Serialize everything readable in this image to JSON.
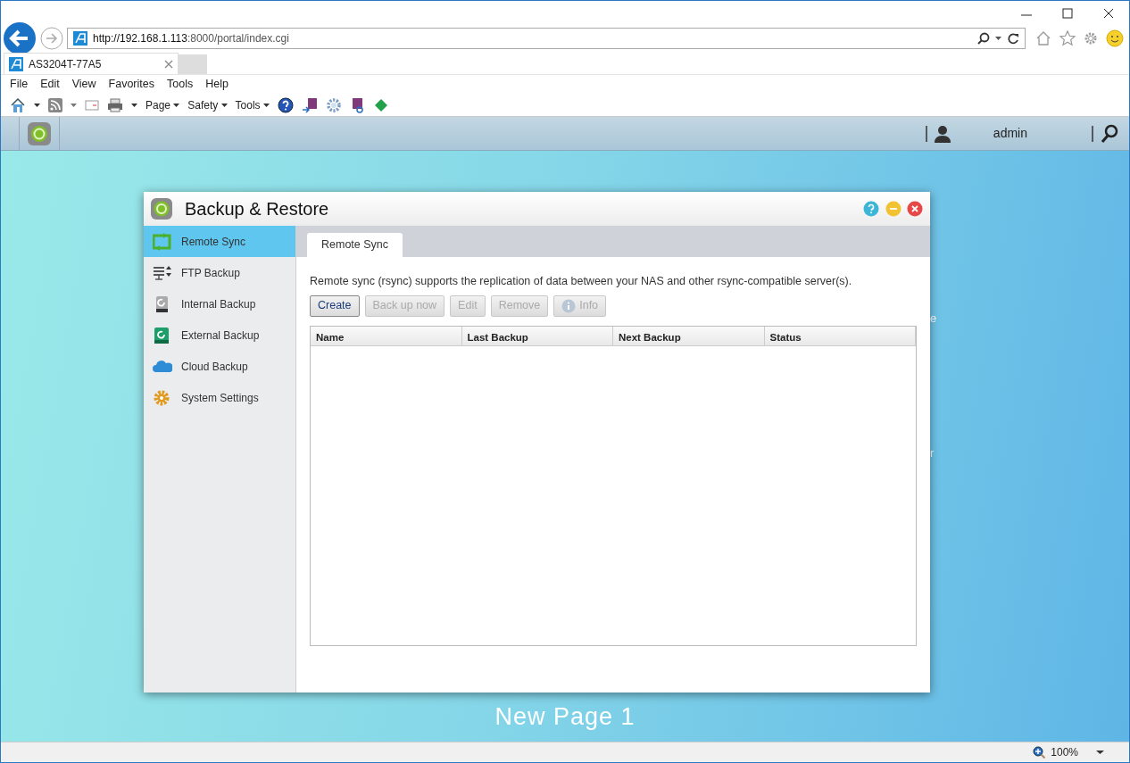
{
  "browser": {
    "address_host": "http://192.168.1.113",
    "address_rest": ":8000/portal/index.cgi",
    "tab_title": "AS3204T-77A5",
    "menu": [
      "File",
      "Edit",
      "View",
      "Favorites",
      "Tools",
      "Help"
    ],
    "toolbar": [
      "Page",
      "Safety",
      "Tools"
    ],
    "zoom": "100%"
  },
  "app_bar": {
    "user": "admin"
  },
  "desktop": {
    "peek_labels": [
      "e",
      "r"
    ],
    "page_label": "New Page 1"
  },
  "window": {
    "title": "Backup & Restore",
    "sidebar": {
      "items": [
        {
          "label": "Remote Sync",
          "kind": "sync",
          "selected": true
        },
        {
          "label": "FTP Backup",
          "kind": "ftp",
          "selected": false
        },
        {
          "label": "Internal Backup",
          "kind": "internal",
          "selected": false
        },
        {
          "label": "External Backup",
          "kind": "external",
          "selected": false
        },
        {
          "label": "Cloud Backup",
          "kind": "cloud",
          "selected": false
        },
        {
          "label": "System Settings",
          "kind": "settings",
          "selected": false
        }
      ]
    },
    "tabs": [
      {
        "label": "Remote Sync",
        "selected": true
      }
    ],
    "description": "Remote sync (rsync) supports the replication of data between your NAS and other rsync-compatible server(s).",
    "buttons": [
      {
        "label": "Create",
        "disabled": false
      },
      {
        "label": "Back up now",
        "disabled": true
      },
      {
        "label": "Edit",
        "disabled": true
      },
      {
        "label": "Remove",
        "disabled": true
      },
      {
        "label": "Info",
        "disabled": true,
        "kind": "info"
      }
    ],
    "table": {
      "columns": [
        "Name",
        "Last Backup",
        "Next Backup",
        "Status"
      ]
    }
  }
}
